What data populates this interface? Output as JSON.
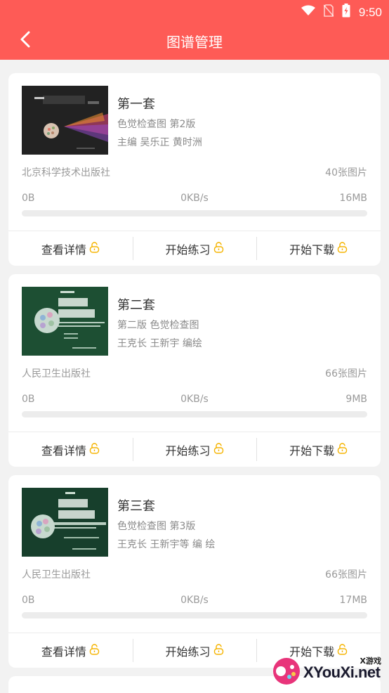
{
  "status_bar": {
    "time": "9:50"
  },
  "header": {
    "title": "图谱管理"
  },
  "cards": [
    {
      "title": "第一套",
      "subtitle": "色觉检查图 第2版",
      "author": "主编 吴乐正 黄时洲",
      "publisher": "北京科学技术出版社",
      "count": "40张图片",
      "downloaded": "0B",
      "speed": "0KB/s",
      "size": "16MB",
      "progress_fraction": 0,
      "cover_color": "#222222",
      "actions": [
        "查看详情",
        "开始练习",
        "开始下载"
      ]
    },
    {
      "title": "第二套",
      "subtitle": "第二版 色觉检查图",
      "author": "王克长 王新宇 编绘",
      "publisher": "人民卫生出版社",
      "count": "66张图片",
      "downloaded": "0B",
      "speed": "0KB/s",
      "size": "9MB",
      "progress_fraction": 0,
      "cover_color": "#1d4f33",
      "actions": [
        "查看详情",
        "开始练习",
        "开始下载"
      ]
    },
    {
      "title": "第三套",
      "subtitle": "色觉检查图 第3版",
      "author": "王克长 王新宇等 编 绘",
      "publisher": "人民卫生出版社",
      "count": "66张图片",
      "downloaded": "0B",
      "speed": "0KB/s",
      "size": "17MB",
      "progress_fraction": 0,
      "cover_color": "#173f2c",
      "actions": [
        "查看详情",
        "开始练习",
        "开始下载"
      ]
    }
  ],
  "icons": {
    "back": "chevron-left-icon",
    "lock": "lock-icon"
  },
  "colors": {
    "accent": "#fe5b56",
    "lock": "#f5b400"
  },
  "watermark": {
    "main": "XYouXi.net",
    "top": "X游戏"
  }
}
